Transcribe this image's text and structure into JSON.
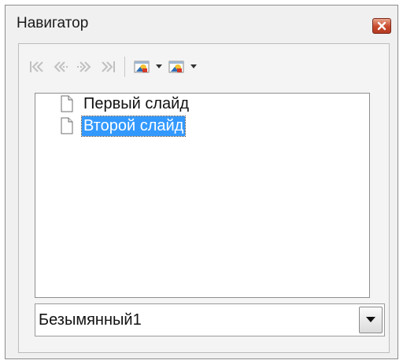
{
  "window": {
    "title": "Навигатор"
  },
  "toolbar": {
    "buttons": [
      {
        "name": "first-slide",
        "icon": "first-icon",
        "enabled": false
      },
      {
        "name": "previous-slide",
        "icon": "previous-icon",
        "enabled": false
      },
      {
        "name": "next-slide",
        "icon": "next-icon",
        "enabled": false
      },
      {
        "name": "last-slide",
        "icon": "last-icon",
        "enabled": false
      },
      {
        "name": "drag-mode",
        "icon": "drag-mode-icon",
        "enabled": true
      },
      {
        "name": "shapes",
        "icon": "shapes-icon",
        "enabled": true
      }
    ]
  },
  "tree": {
    "items": [
      {
        "label": "Первый слайд",
        "selected": false,
        "icon": "slide-page-icon"
      },
      {
        "label": "Второй слайд",
        "selected": true,
        "icon": "slide-page-icon"
      }
    ]
  },
  "document_select": {
    "value": "Безымянный1"
  },
  "colors": {
    "selection": "#3399ff",
    "close_button": "#c8492c",
    "disabled_icon": "#c0c0c0"
  }
}
